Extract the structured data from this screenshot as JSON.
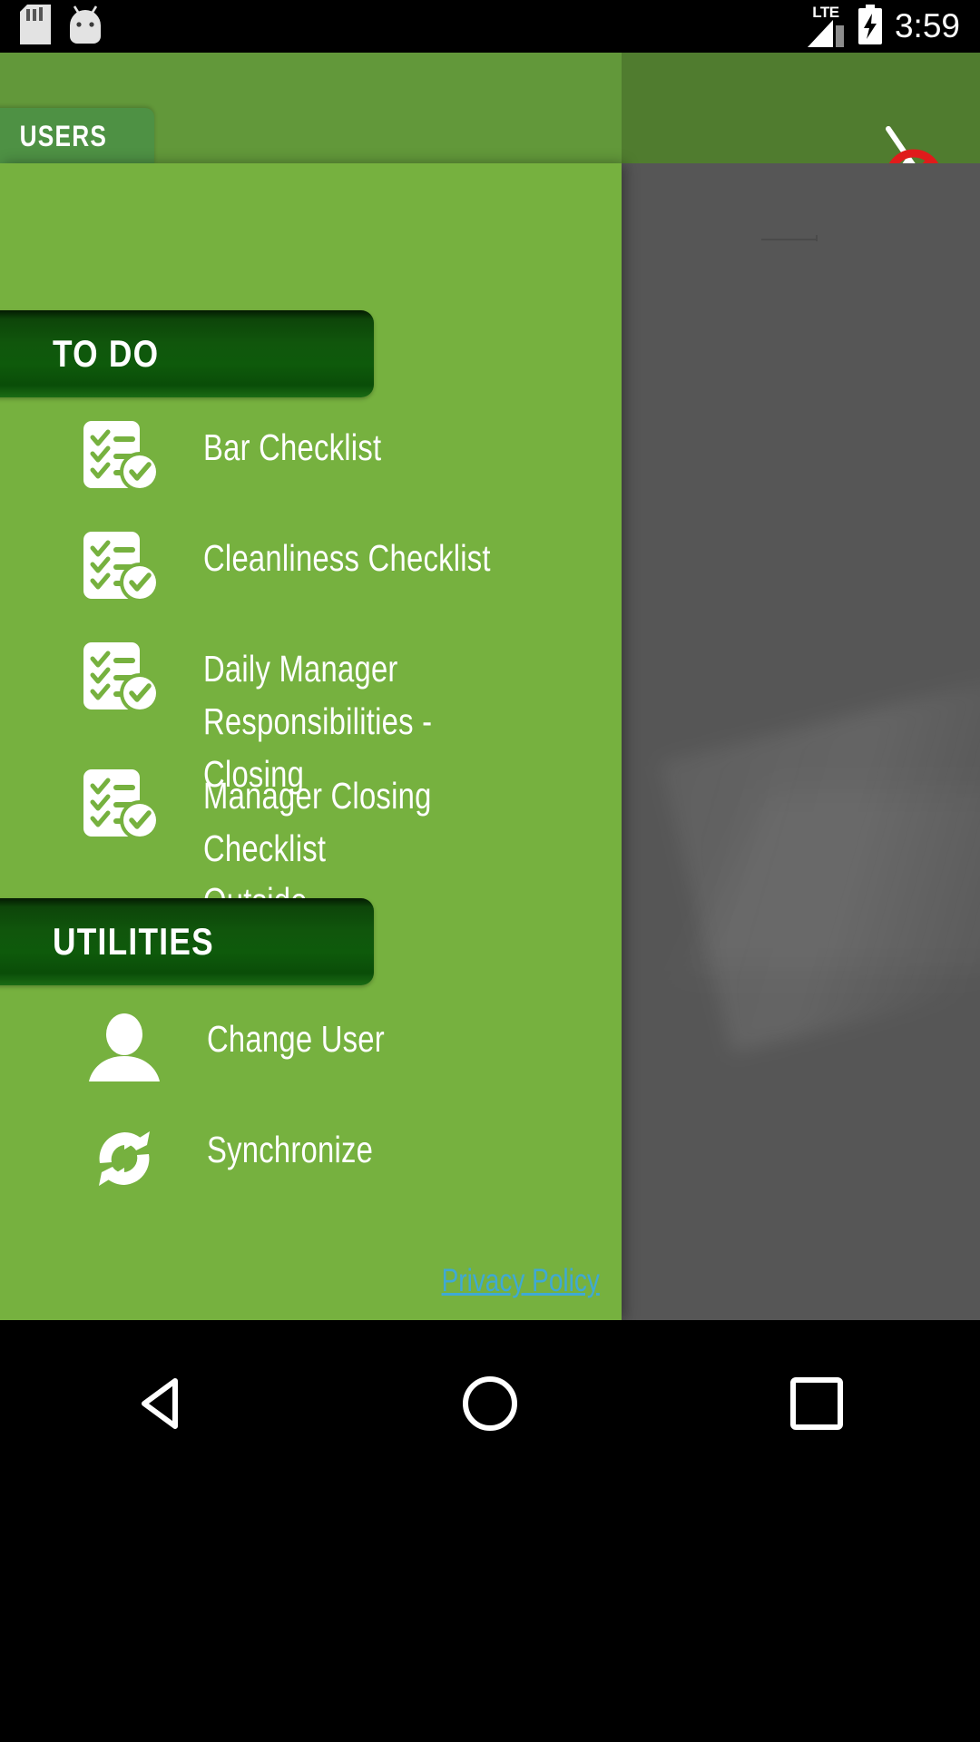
{
  "status_bar": {
    "icons": [
      "sd-card-icon",
      "android-head-icon"
    ],
    "network_label": "LTE",
    "signal_icon": "signal-bars-icon",
    "battery_icon": "battery-charging-icon",
    "time": "3:59"
  },
  "app_bar": {
    "tab_label": "USERS",
    "right_icon_name": "no-sync-pin-icon",
    "bg_color": "#62983a",
    "tab_color": "#4e9144"
  },
  "drawer": {
    "bg_color": "#76b13f",
    "sections": [
      {
        "title": "TO DO",
        "items": [
          {
            "label": "Bar Checklist",
            "icon": "checklist-icon"
          },
          {
            "label": "Cleanliness Checklist",
            "icon": "checklist-icon"
          },
          {
            "label": "Daily Manager\nResponsibilities - Closing",
            "icon": "checklist-icon"
          },
          {
            "label": "Manager Closing Checklist\nOutside",
            "icon": "checklist-icon"
          }
        ]
      },
      {
        "title": "UTILITIES",
        "items": [
          {
            "label": "Change User",
            "icon": "user-icon"
          },
          {
            "label": "Synchronize",
            "icon": "sync-refresh-icon"
          }
        ]
      }
    ],
    "footer_link": "Privacy Policy",
    "footer_link_color": "#3fa9d4"
  },
  "nav_bar": {
    "buttons": [
      {
        "name": "back-button",
        "icon": "triangle-back-icon"
      },
      {
        "name": "home-button",
        "icon": "circle-home-icon"
      },
      {
        "name": "recents-button",
        "icon": "square-recents-icon"
      }
    ]
  }
}
